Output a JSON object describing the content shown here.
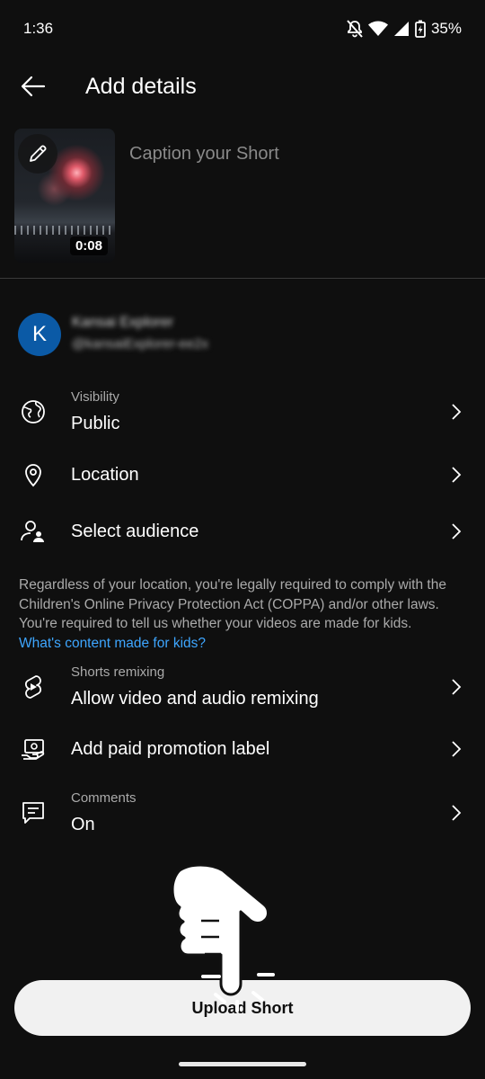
{
  "status_bar": {
    "time": "1:36",
    "battery": "35%"
  },
  "header": {
    "title": "Add details"
  },
  "video": {
    "duration": "0:08",
    "caption_placeholder": "Caption your Short"
  },
  "account": {
    "initial": "K",
    "name": "Kansai Explorer",
    "handle": "@kansaiExplorer-ee2x"
  },
  "rows": {
    "visibility": {
      "label": "Visibility",
      "value": "Public"
    },
    "location": {
      "value": "Location"
    },
    "audience": {
      "value": "Select audience"
    },
    "remixing": {
      "label": "Shorts remixing",
      "value": "Allow video and audio remixing"
    },
    "promotion": {
      "value": "Add paid promotion label"
    },
    "comments": {
      "label": "Comments",
      "value": "On"
    }
  },
  "notice": {
    "text": "Regardless of your location, you're legally required to comply with the Children's Online Privacy Protection Act (COPPA) and/or other laws. You're required to tell us whether your videos are made for kids.",
    "link": "What's content made for kids?"
  },
  "upload_button": {
    "label": "Upload Short"
  },
  "colors": {
    "background": "#0f0f0f",
    "link": "#3ea6ff",
    "avatar": "#0b5aa6",
    "button": "#f1f1f1"
  }
}
